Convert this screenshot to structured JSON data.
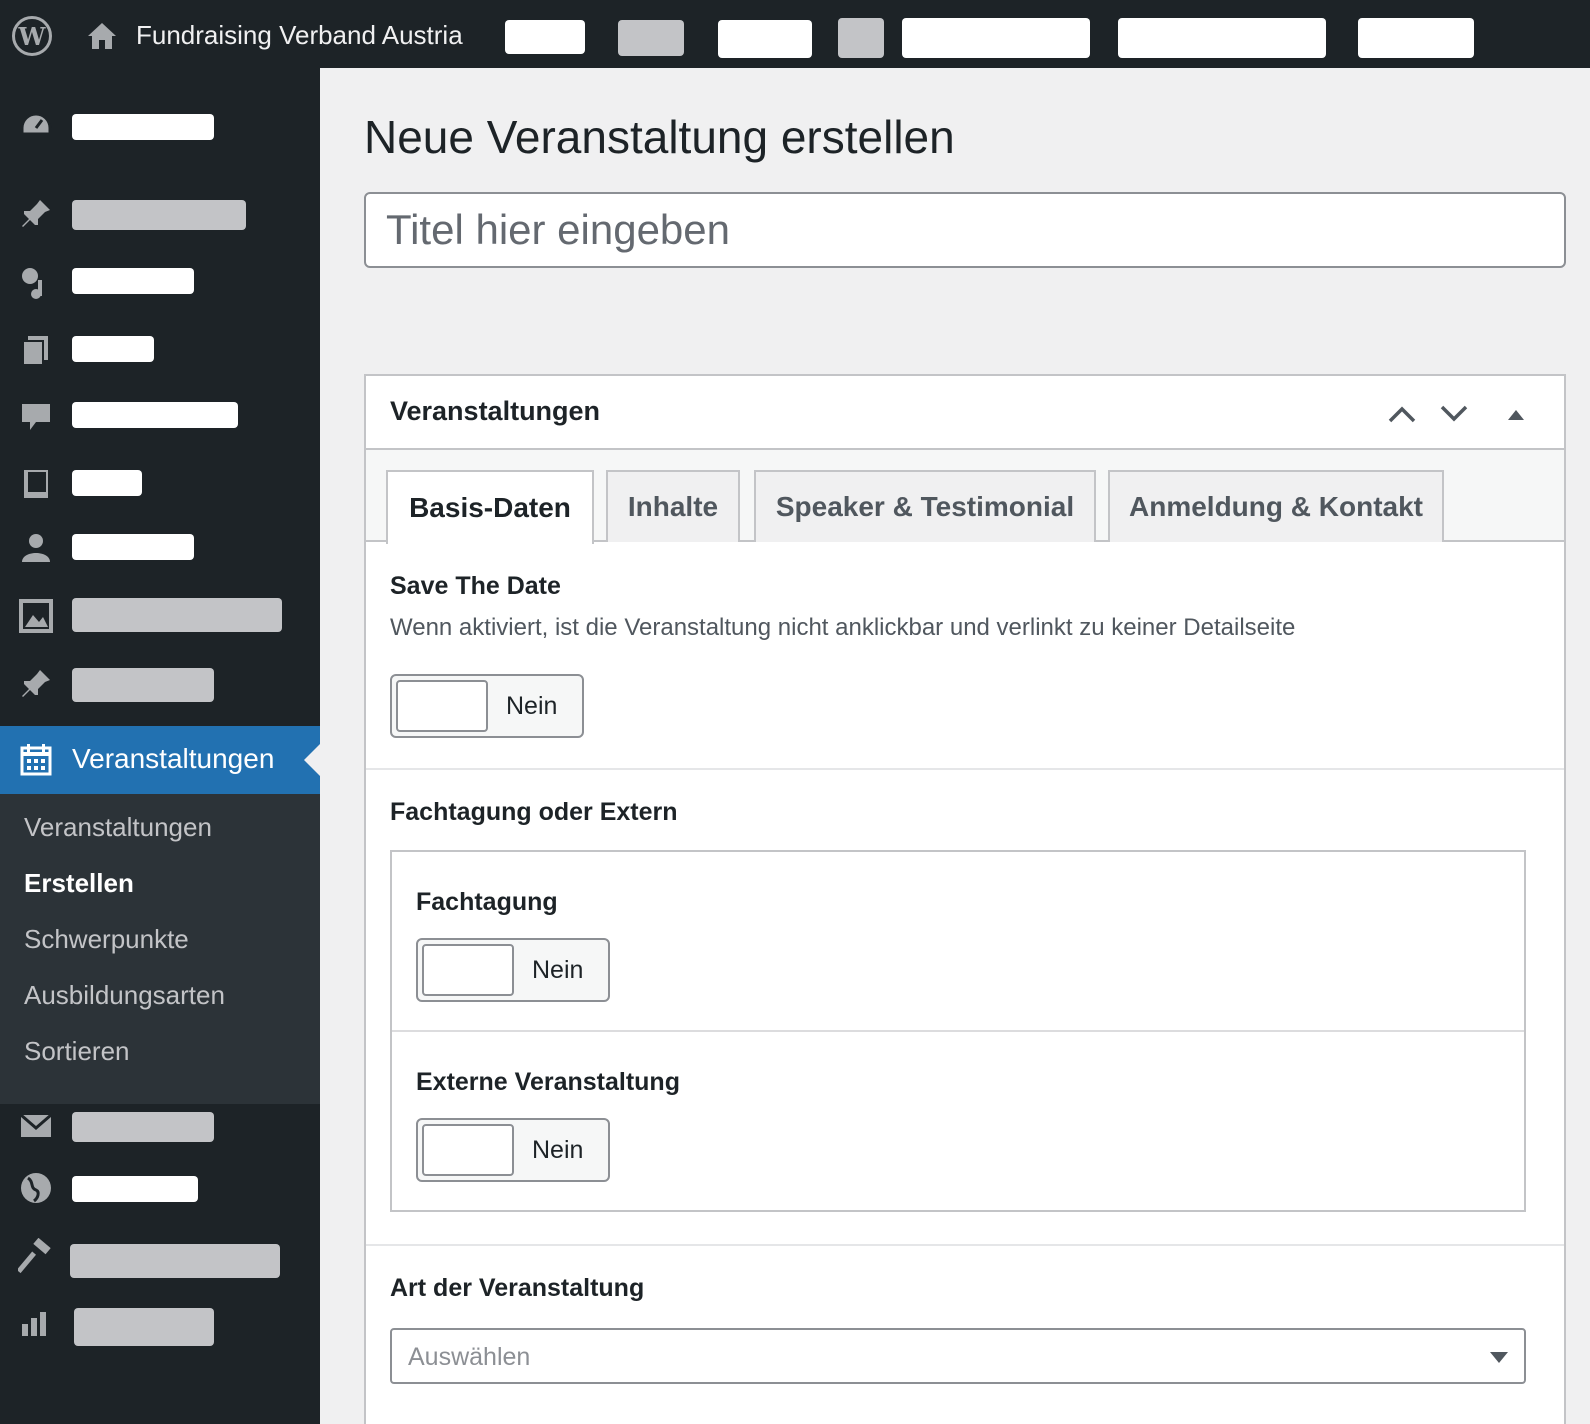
{
  "adminbar": {
    "wp_logo_icon": "wordpress-logo-icon",
    "home_icon": "home-icon",
    "site_name": "Fundraising Verband Austria"
  },
  "sidebar": {
    "icons": [
      "dashboard-icon",
      "pin-icon",
      "media-icon",
      "pages-icon",
      "comments-icon",
      "book-icon",
      "user-icon",
      "gallery-icon",
      "pin-icon",
      "calendar-icon",
      "mail-icon",
      "globe-icon",
      "hammer-icon",
      "chart-icon"
    ],
    "active_item": {
      "label": "Veranstaltungen",
      "icon": "calendar-icon"
    },
    "submenu": [
      {
        "label": "Veranstaltungen",
        "current": false
      },
      {
        "label": "Erstellen",
        "current": true
      },
      {
        "label": "Schwerpunkte",
        "current": false
      },
      {
        "label": "Ausbildungsarten",
        "current": false
      },
      {
        "label": "Sortieren",
        "current": false
      }
    ]
  },
  "main": {
    "page_title": "Neue Veranstaltung erstellen",
    "title_input": {
      "value": "",
      "placeholder": "Titel hier eingeben"
    }
  },
  "metabox": {
    "title": "Veranstaltungen",
    "controls": [
      "chevron-up-icon",
      "chevron-down-icon",
      "triangle-up-icon"
    ],
    "tabs": [
      {
        "label": "Basis-Daten",
        "active": true
      },
      {
        "label": "Inhalte",
        "active": false
      },
      {
        "label": "Speaker & Testimonial",
        "active": false
      },
      {
        "label": "Anmeldung & Kontakt",
        "active": false
      }
    ],
    "save_the_date": {
      "label": "Save The Date",
      "description": "Wenn aktiviert, ist die Veranstaltung nicht anklickbar und verlinkt zu keiner Detailseite",
      "toggle_text": "Nein"
    },
    "fachtagung_extern": {
      "label": "Fachtagung oder Extern",
      "fachtagung": {
        "label": "Fachtagung",
        "toggle_text": "Nein"
      },
      "extern": {
        "label": "Externe Veranstaltung",
        "toggle_text": "Nein"
      }
    },
    "art": {
      "label": "Art der Veranstaltung",
      "select_value": "Auswählen"
    }
  },
  "colors": {
    "adminbar_bg": "#1d2327",
    "accent": "#2271b1",
    "submenu_bg": "#2c3338"
  }
}
